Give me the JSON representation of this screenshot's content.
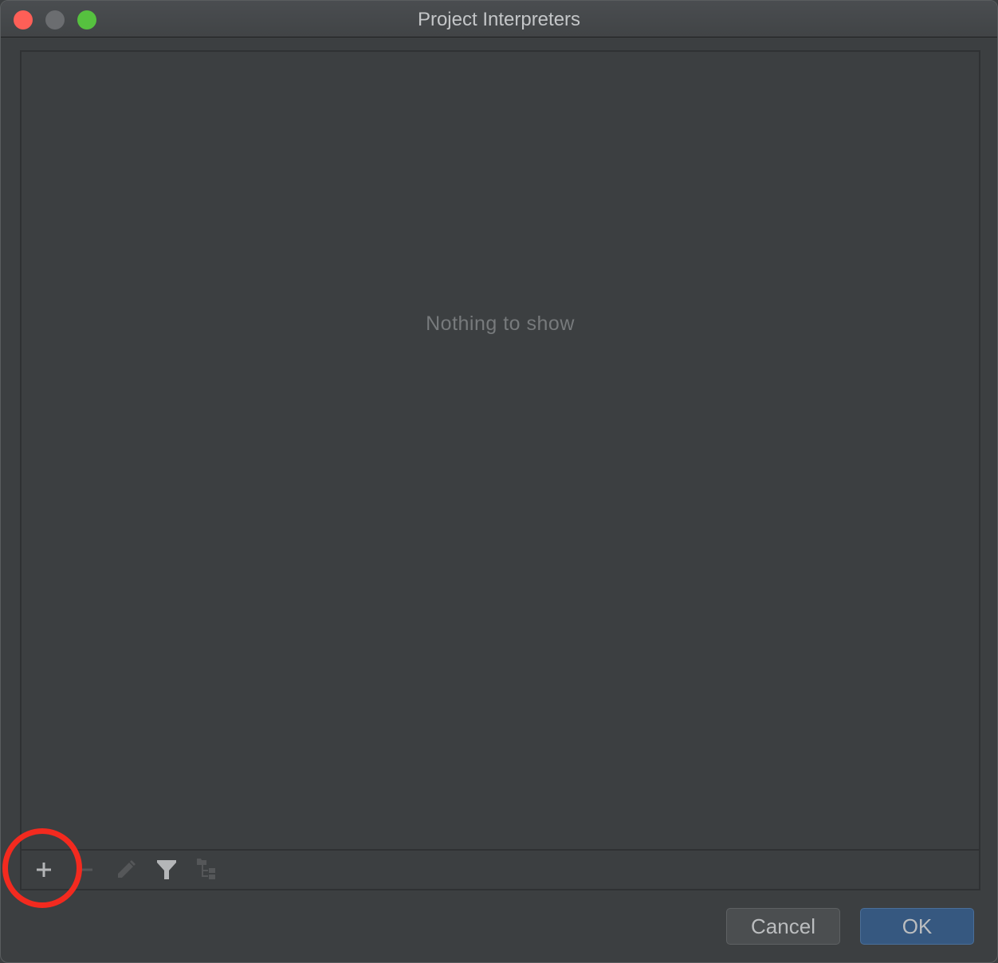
{
  "window": {
    "title": "Project Interpreters",
    "controls": [
      {
        "name": "close",
        "color": "#fe5f57"
      },
      {
        "name": "minimize",
        "color": "#6b6d70"
      },
      {
        "name": "maximize",
        "color": "#56c13f"
      }
    ]
  },
  "list": {
    "empty_text": "Nothing to show"
  },
  "toolbar": {
    "items": [
      {
        "icon": "plus-icon",
        "label": "Add",
        "enabled": true
      },
      {
        "icon": "minus-icon",
        "label": "Remove",
        "enabled": false
      },
      {
        "icon": "pencil-icon",
        "label": "Edit",
        "enabled": false
      },
      {
        "icon": "filter-icon",
        "label": "Filter",
        "enabled": true
      },
      {
        "icon": "tree-icon",
        "label": "Show paths",
        "enabled": false
      }
    ]
  },
  "buttons": {
    "cancel": "Cancel",
    "ok": "OK"
  },
  "annotation": {
    "type": "circle",
    "target": "Add",
    "color": "#f32a1f"
  }
}
